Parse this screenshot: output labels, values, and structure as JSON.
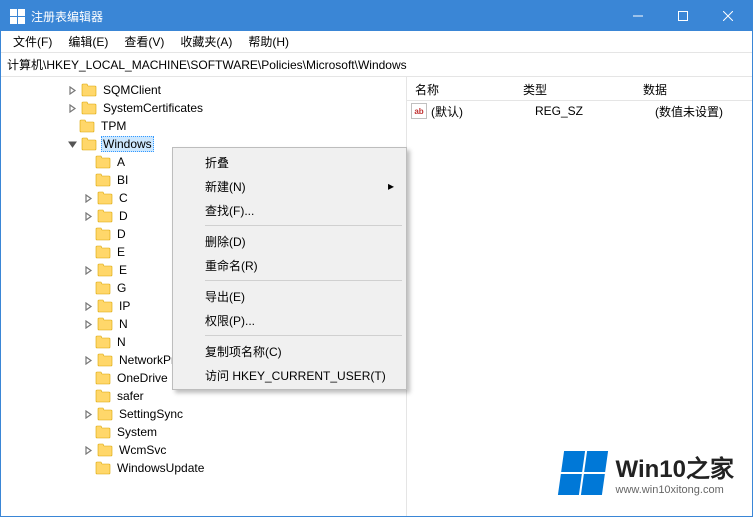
{
  "titlebar": {
    "title": "注册表编辑器"
  },
  "menubar": {
    "file": "文件(F)",
    "edit": "编辑(E)",
    "view": "查看(V)",
    "favorites": "收藏夹(A)",
    "help": "帮助(H)"
  },
  "addressbar": {
    "path": "计算机\\HKEY_LOCAL_MACHINE\\SOFTWARE\\Policies\\Microsoft\\Windows"
  },
  "tree": {
    "items": [
      {
        "indent": 4,
        "exp": "closed",
        "label": "SQMClient"
      },
      {
        "indent": 4,
        "exp": "closed",
        "label": "SystemCertificates"
      },
      {
        "indent": 4,
        "exp": "none",
        "label": "TPM"
      },
      {
        "indent": 4,
        "exp": "open",
        "label": "Windows",
        "selected": true
      },
      {
        "indent": 5,
        "exp": "none",
        "label": "A"
      },
      {
        "indent": 5,
        "exp": "none",
        "label": "BI"
      },
      {
        "indent": 5,
        "exp": "closed",
        "label": "C"
      },
      {
        "indent": 5,
        "exp": "closed",
        "label": "D"
      },
      {
        "indent": 5,
        "exp": "none",
        "label": "D"
      },
      {
        "indent": 5,
        "exp": "none",
        "label": "E"
      },
      {
        "indent": 5,
        "exp": "closed",
        "label": "E"
      },
      {
        "indent": 5,
        "exp": "none",
        "label": "G"
      },
      {
        "indent": 5,
        "exp": "closed",
        "label": "IP"
      },
      {
        "indent": 5,
        "exp": "closed",
        "label": "N"
      },
      {
        "indent": 5,
        "exp": "none",
        "label": "N"
      },
      {
        "indent": 5,
        "exp": "closed",
        "label": "NetworkProvider"
      },
      {
        "indent": 5,
        "exp": "none",
        "label": "OneDrive"
      },
      {
        "indent": 5,
        "exp": "none",
        "label": "safer"
      },
      {
        "indent": 5,
        "exp": "closed",
        "label": "SettingSync"
      },
      {
        "indent": 5,
        "exp": "none",
        "label": "System"
      },
      {
        "indent": 5,
        "exp": "closed",
        "label": "WcmSvc"
      },
      {
        "indent": 5,
        "exp": "none",
        "label": "WindowsUpdate"
      }
    ]
  },
  "list": {
    "columns": {
      "name": "名称",
      "type": "类型",
      "data": "数据"
    },
    "rows": [
      {
        "name": "(默认)",
        "type": "REG_SZ",
        "data": "(数值未设置)"
      }
    ]
  },
  "context_menu": {
    "collapse": "折叠",
    "new": "新建(N)",
    "find": "查找(F)...",
    "delete": "删除(D)",
    "rename": "重命名(R)",
    "export": "导出(E)",
    "permissions": "权限(P)...",
    "copy_key_name": "复制项名称(C)",
    "goto_hkcu": "访问 HKEY_CURRENT_USER(T)"
  },
  "watermark": {
    "brand": "Win10之家",
    "url": "www.win10xitong.com"
  }
}
